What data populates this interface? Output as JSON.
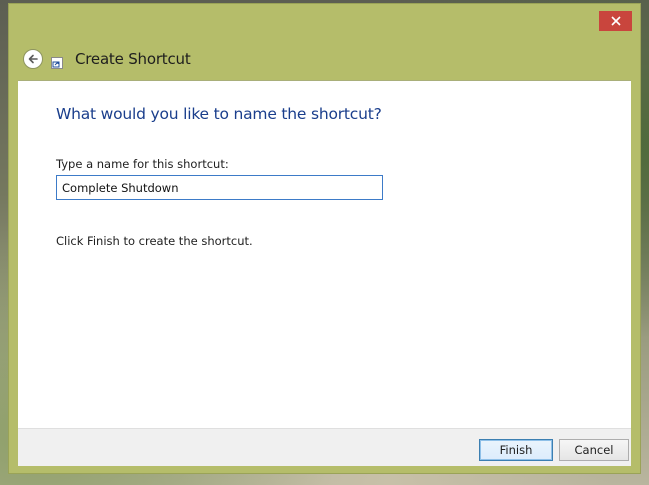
{
  "window": {
    "title": "Create Shortcut",
    "close_icon": "close-icon",
    "back_icon": "back-arrow-icon",
    "app_icon": "shortcut-icon"
  },
  "content": {
    "heading": "What would you like to name the shortcut?",
    "field_label": "Type a name for this shortcut:",
    "name_value": "Complete Shutdown",
    "instruction": "Click Finish to create the shortcut."
  },
  "buttons": {
    "finish_label": "Finish",
    "cancel_label": "Cancel"
  },
  "colors": {
    "frame": "#b5bd6a",
    "close": "#c9453d",
    "heading": "#1a3e8c",
    "input_border": "#3d7bc8"
  }
}
